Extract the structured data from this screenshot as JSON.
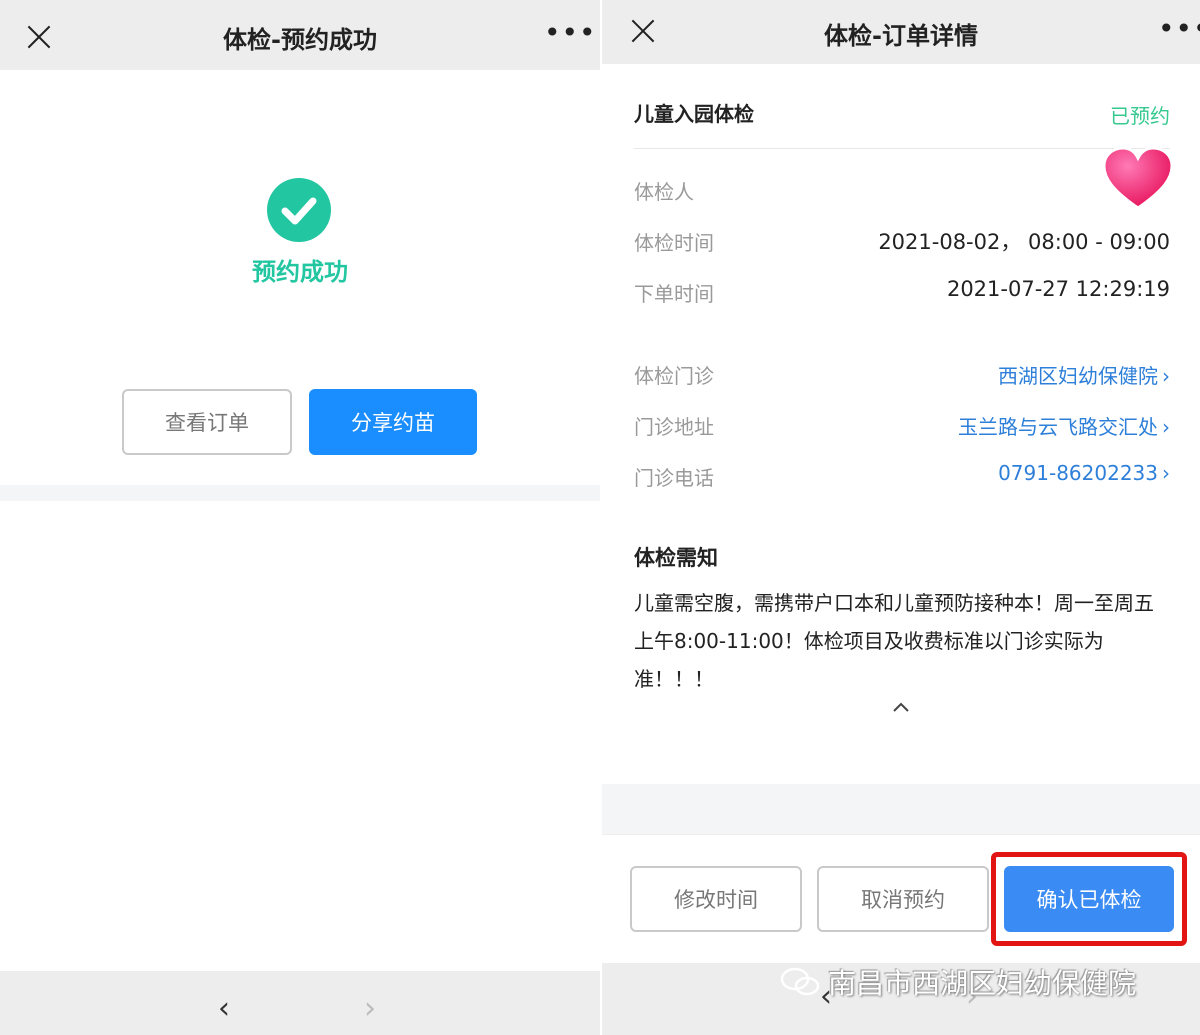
{
  "left": {
    "header": {
      "title": "体检-预约成功"
    },
    "success_text": "预约成功",
    "buttons": {
      "view_order": "查看订单",
      "share": "分享约苗"
    }
  },
  "right": {
    "header": {
      "title": "体检-订单详情"
    },
    "order": {
      "name": "儿童入园体检",
      "status": "已预约"
    },
    "info_rows": [
      {
        "label": "体检人",
        "value": ""
      },
      {
        "label": "体检时间",
        "value": "2021-08-02，   08:00 - 09:00"
      },
      {
        "label": "下单时间",
        "value": "2021-07-27 12:29:19"
      }
    ],
    "clinic_rows": [
      {
        "label": "体检门诊",
        "value": "西湖区妇幼保健院"
      },
      {
        "label": "门诊地址",
        "value": "玉兰路与云飞路交汇处"
      },
      {
        "label": "门诊电话",
        "value": "0791-86202233"
      }
    ],
    "notice": {
      "title": "体检需知",
      "body": "儿童需空腹，需携带户口本和儿童预防接种本！周一至周五 上午8:00-11:00！体检项目及收费标准以门诊实际为准！！！"
    },
    "buttons": {
      "modify": "修改时间",
      "cancel": "取消预约",
      "confirm": "确认已体检"
    }
  },
  "nav": {
    "back": "‹",
    "forward": "›"
  },
  "watermark": "南昌市西湖区妇幼保健院",
  "colors": {
    "accent_green": "#22c6a1",
    "primary_blue": "#1a8dff",
    "link_blue": "#2d7fd9",
    "highlight_red": "#e31414"
  }
}
